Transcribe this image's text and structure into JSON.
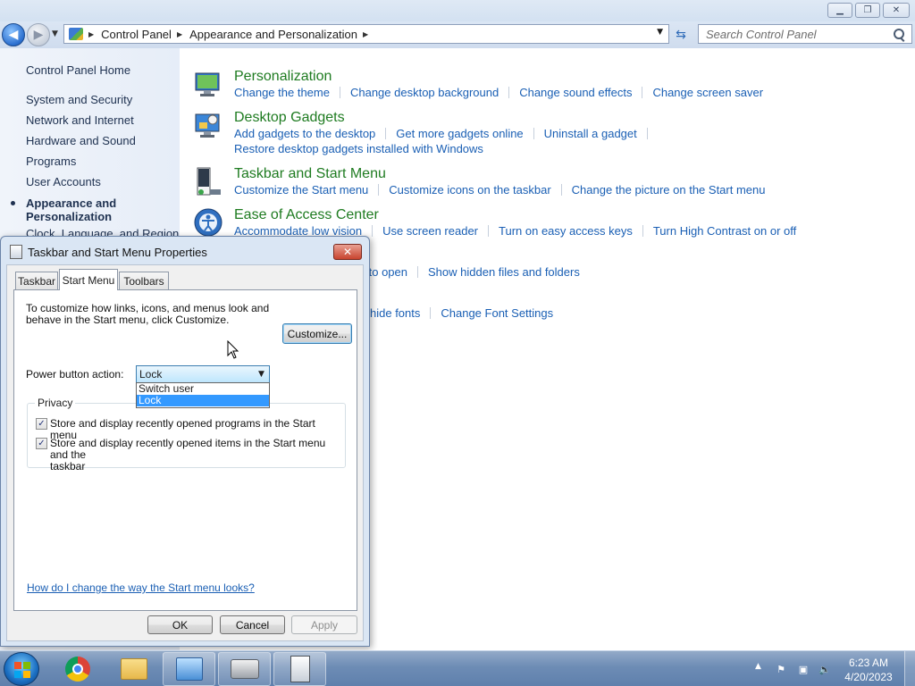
{
  "window": {
    "breadcrumb": [
      "Control Panel",
      "Appearance and Personalization"
    ],
    "search_placeholder": "Search Control Panel"
  },
  "left_pane": {
    "home": "Control Panel Home",
    "items": [
      "System and Security",
      "Network and Internet",
      "Hardware and Sound",
      "Programs",
      "User Accounts"
    ],
    "active_line1": "Appearance and",
    "active_line2": "Personalization",
    "partial": "Clock, Language, and Region"
  },
  "categories": {
    "personalization": {
      "title": "Personalization",
      "links": [
        "Change the theme",
        "Change desktop background",
        "Change sound effects",
        "Change screen saver"
      ]
    },
    "gadgets": {
      "title": "Desktop Gadgets",
      "links": [
        "Add gadgets to the desktop",
        "Get more gadgets online",
        "Uninstall a gadget",
        "Restore desktop gadgets installed with Windows"
      ]
    },
    "taskbar": {
      "title": "Taskbar and Start Menu",
      "links": [
        "Customize the Start menu",
        "Customize icons on the taskbar",
        "Change the picture on the Start menu"
      ]
    },
    "ease": {
      "title": "Ease of Access Center",
      "links": [
        "Accommodate low vision",
        "Use screen reader",
        "Turn on easy access keys",
        "Turn High Contrast on or off"
      ]
    },
    "folder_partial": {
      "links": [
        "ck to open",
        "Show hidden files and folders"
      ]
    },
    "fonts_partial": {
      "links": [
        "hide fonts",
        "Change Font Settings"
      ]
    }
  },
  "dialog": {
    "title": "Taskbar and Start Menu Properties",
    "tabs": [
      "Taskbar",
      "Start Menu",
      "Toolbars"
    ],
    "description_line1": "To customize how links, icons, and menus look and",
    "description_line2": "behave in the Start menu, click Customize.",
    "customize_button": "Customize...",
    "power_label": "Power button action:",
    "power_value": "Lock",
    "power_options": [
      "Switch user",
      "Lock"
    ],
    "privacy_title": "Privacy",
    "privacy_option1": "Store and display recently opened programs in the Start menu",
    "privacy_option2_line1": "Store and display recently opened items in the Start menu and the",
    "privacy_option2_line2": "taskbar",
    "help_link": "How do I change the way the Start menu looks?",
    "ok": "OK",
    "cancel": "Cancel",
    "apply": "Apply"
  },
  "taskbar": {
    "time": "6:23 AM",
    "date": "4/20/2023"
  }
}
